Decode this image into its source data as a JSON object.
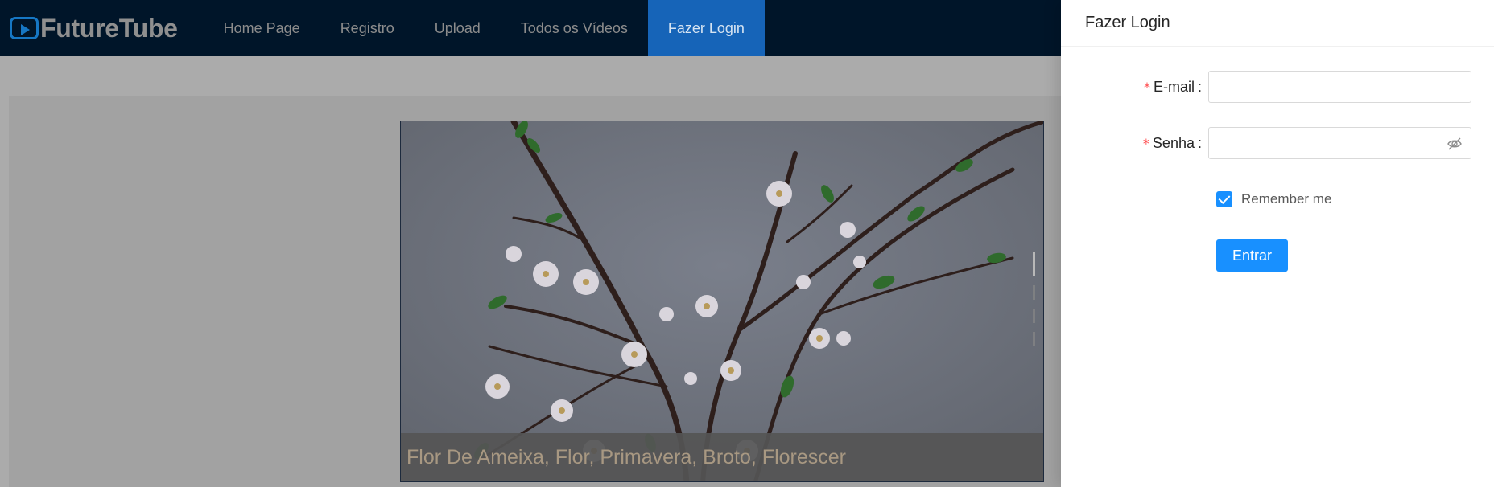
{
  "navbar": {
    "logo_text": "FutureTube",
    "items": [
      {
        "label": "Home Page"
      },
      {
        "label": "Registro"
      },
      {
        "label": "Upload"
      },
      {
        "label": "Todos os Vídeos"
      },
      {
        "label": "Fazer Login",
        "active": true
      }
    ]
  },
  "hero": {
    "caption": "Flor De Ameixa, Flor, Primavera, Broto, Florescer",
    "carousel_slides": 4,
    "active_slide": 1
  },
  "drawer": {
    "title": "Fazer Login",
    "email_label": "E-mail",
    "email_value": "",
    "password_label": "Senha",
    "password_value": "",
    "required_mark": "*",
    "label_colon": ":",
    "remember_label": "Remember me",
    "remember_checked": true,
    "submit_label": "Entrar"
  },
  "colors": {
    "navbar_bg": "#001529",
    "accent": "#1890ff",
    "nav_active": "#1664b8",
    "required": "#ff4d4f"
  }
}
